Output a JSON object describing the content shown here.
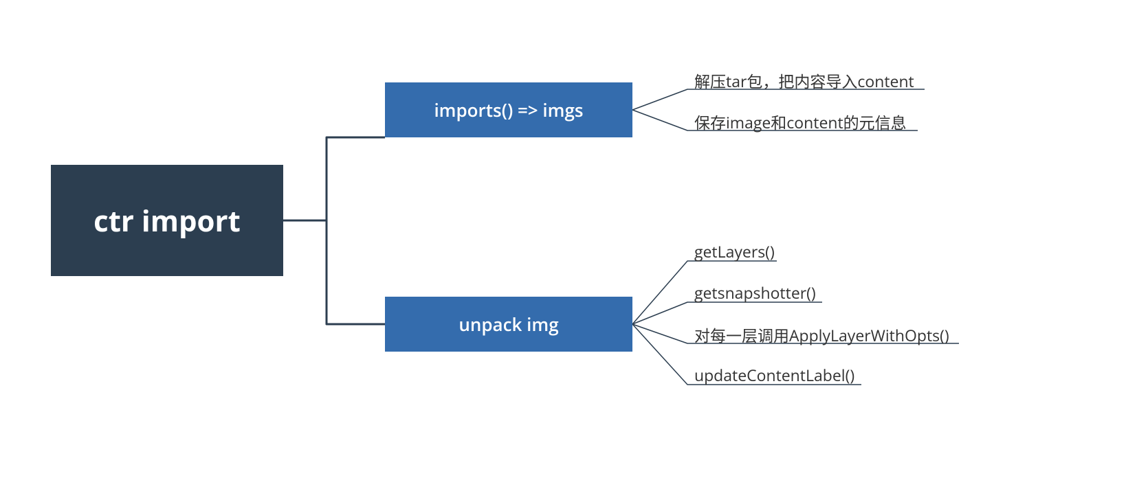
{
  "root": {
    "label": "ctr import"
  },
  "branches": [
    {
      "label": "imports()  => imgs",
      "leaves": [
        "解压tar包，把内容导入content",
        "保存image和content的元信息"
      ]
    },
    {
      "label": "unpack img",
      "leaves": [
        "getLayers()",
        "getsnapshotter()",
        "对每一层调用ApplyLayerWithOpts()",
        "updateContentLabel()"
      ]
    }
  ]
}
